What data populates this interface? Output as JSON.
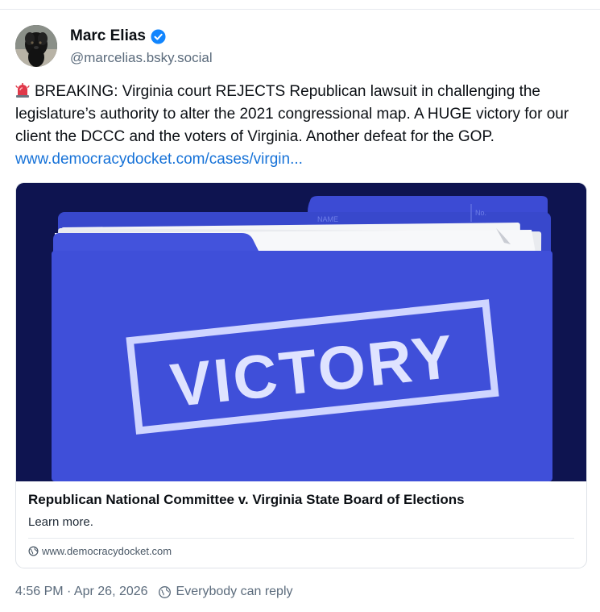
{
  "author": {
    "display_name": "Marc Elias",
    "handle": "@marcelias.bsky.social",
    "verified_icon": "verified-check-icon",
    "avatar_icon": "dog-avatar"
  },
  "post": {
    "emoji": "police-light-icon",
    "text": "BREAKING: Virginia court REJECTS Republican lawsuit in challenging the legislature’s authority to alter the 2021 congressional map. A HUGE victory for our client the DCCC and the voters of Virginia. Another defeat for the GOP. ",
    "link_text": "www.democracydocket.com/cases/virgin..."
  },
  "card": {
    "image_text": "VICTORY",
    "tab_name_label": "NAME",
    "tab_no_label": "No.",
    "title": "Republican National Committee v. Virginia State Board of Elections",
    "description": "Learn more.",
    "domain": "www.democracydocket.com",
    "colors": {
      "background": "#0e1450",
      "folder": "#3f4fd9"
    }
  },
  "meta": {
    "timestamp": "4:56 PM · Apr 26, 2026",
    "reply_setting": "Everybody can reply"
  },
  "colors": {
    "link": "#1672d8",
    "verified": "#1185fe",
    "muted": "#5b6b7c"
  }
}
